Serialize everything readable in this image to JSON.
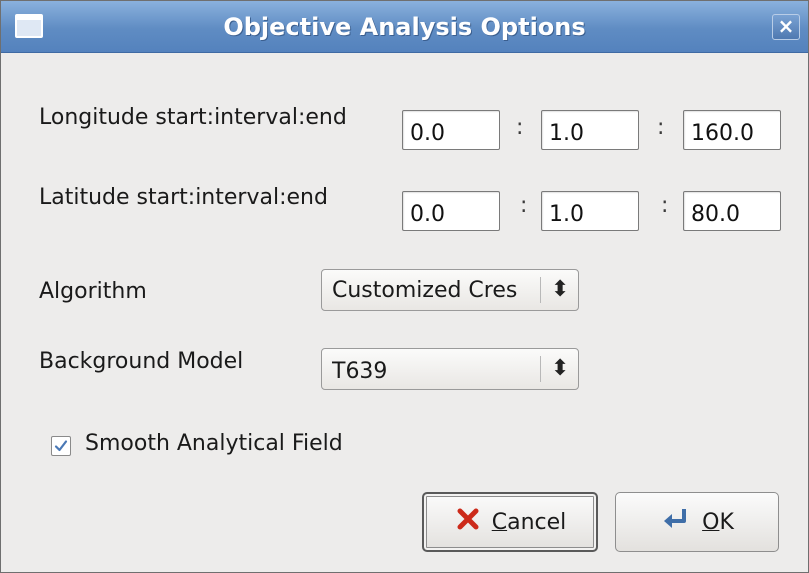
{
  "window": {
    "title": "Objective Analysis Options",
    "close_glyph": "×",
    "menu_icon": "window-menu-icon",
    "close_icon": "close-icon"
  },
  "longitude": {
    "label": "Longitude start:interval:end",
    "start": "0.0",
    "interval": "1.0",
    "end": "160.0",
    "separator": ":"
  },
  "latitude": {
    "label": "Latitude start:interval:end",
    "start": "0.0",
    "interval": "1.0",
    "end": "80.0",
    "separator": ":"
  },
  "algorithm": {
    "label": "Algorithm",
    "selected": "Customized Cres",
    "arrow_glyph": "⬍"
  },
  "background_model": {
    "label": "Background Model",
    "selected": "T639",
    "arrow_glyph": "⬍"
  },
  "smooth": {
    "label": "Smooth Analytical Field",
    "checked": true
  },
  "buttons": {
    "cancel": {
      "mnemonic": "C",
      "rest": "ancel",
      "icon": "cancel-x-icon",
      "icon_color": "#cc2a1a"
    },
    "ok": {
      "mnemonic": "O",
      "rest": "K",
      "icon": "return-arrow-icon",
      "icon_color": "#3f6ea8"
    }
  },
  "colors": {
    "titlebar": "#5f8cc3",
    "dialog_bg": "#edeceb",
    "checkmark": "#4a78b5"
  }
}
